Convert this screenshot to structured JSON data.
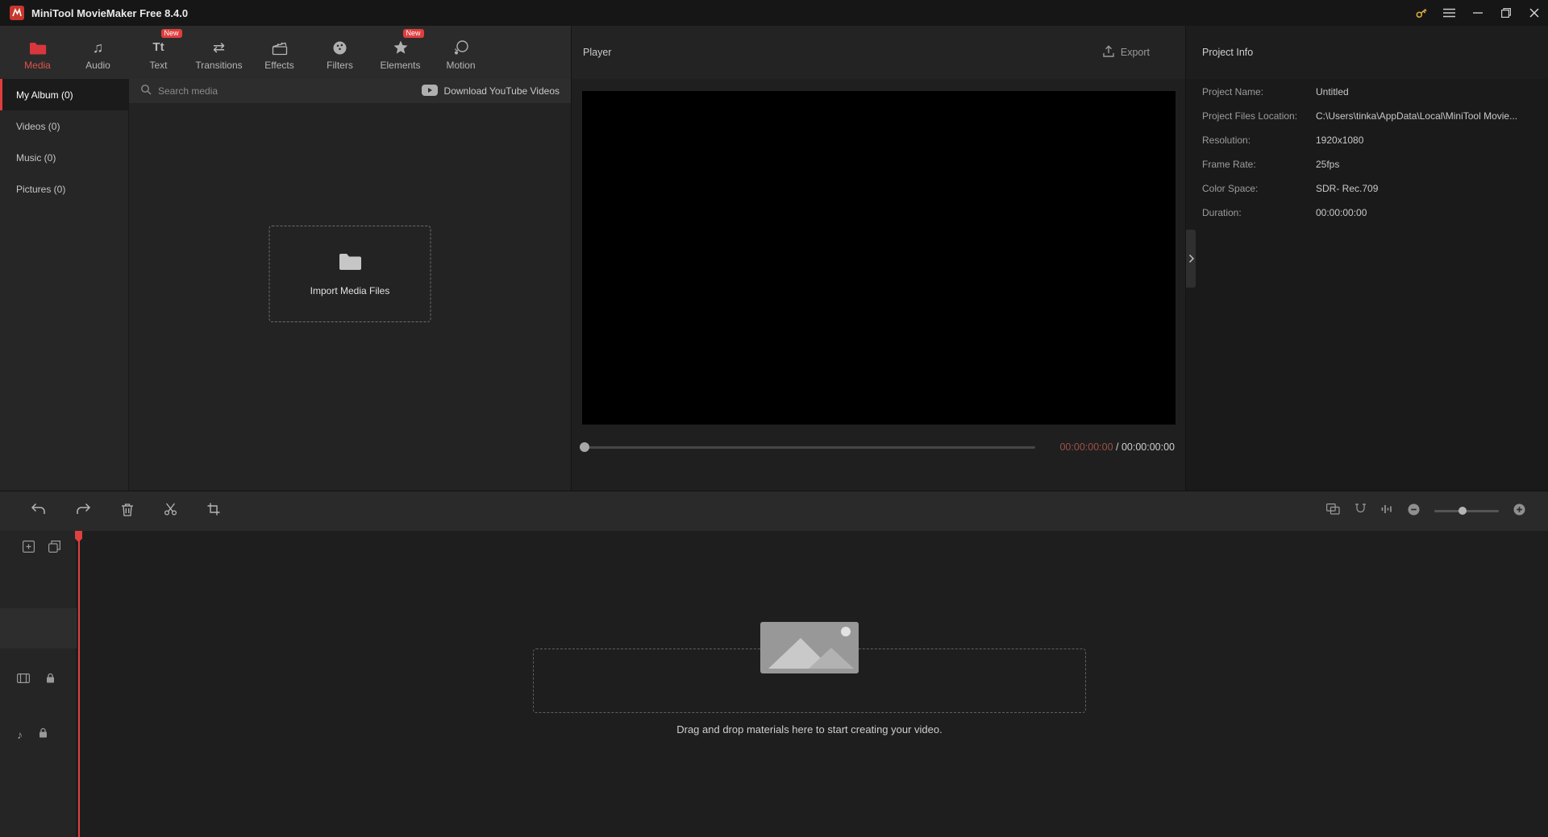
{
  "titlebar": {
    "title": "MiniTool MovieMaker Free 8.4.0"
  },
  "toolbar": {
    "tabs": [
      {
        "label": "Media"
      },
      {
        "label": "Audio"
      },
      {
        "label": "Text",
        "badge": "New"
      },
      {
        "label": "Transitions"
      },
      {
        "label": "Effects"
      },
      {
        "label": "Filters"
      },
      {
        "label": "Elements",
        "badge": "New"
      },
      {
        "label": "Motion"
      }
    ]
  },
  "library": {
    "nav": [
      {
        "label": "My Album (0)"
      },
      {
        "label": "Videos (0)"
      },
      {
        "label": "Music (0)"
      },
      {
        "label": "Pictures (0)"
      }
    ],
    "search_placeholder": "Search media",
    "youtube_button": "Download YouTube Videos",
    "import_button": "Import Media Files"
  },
  "player": {
    "title": "Player",
    "export_button": "Export",
    "current_time": "00:00:00:00",
    "time_separator": " / ",
    "total_time": "00:00:00:00",
    "aspect_ratio": "16:9"
  },
  "project_info": {
    "title": "Project Info",
    "rows": [
      {
        "label": "Project Name:",
        "value": "Untitled"
      },
      {
        "label": "Project Files Location:",
        "value": "C:\\Users\\tinka\\AppData\\Local\\MiniTool Movie..."
      },
      {
        "label": "Resolution:",
        "value": "1920x1080"
      },
      {
        "label": "Frame Rate:",
        "value": "25fps"
      },
      {
        "label": "Color Space:",
        "value": "SDR- Rec.709"
      },
      {
        "label": "Duration:",
        "value": "00:00:00:00"
      }
    ]
  },
  "timeline": {
    "drop_hint": "Drag and drop materials here to start creating your video."
  },
  "colors": {
    "accent_red": "#e03e3e",
    "time_current": "#9c5147"
  }
}
